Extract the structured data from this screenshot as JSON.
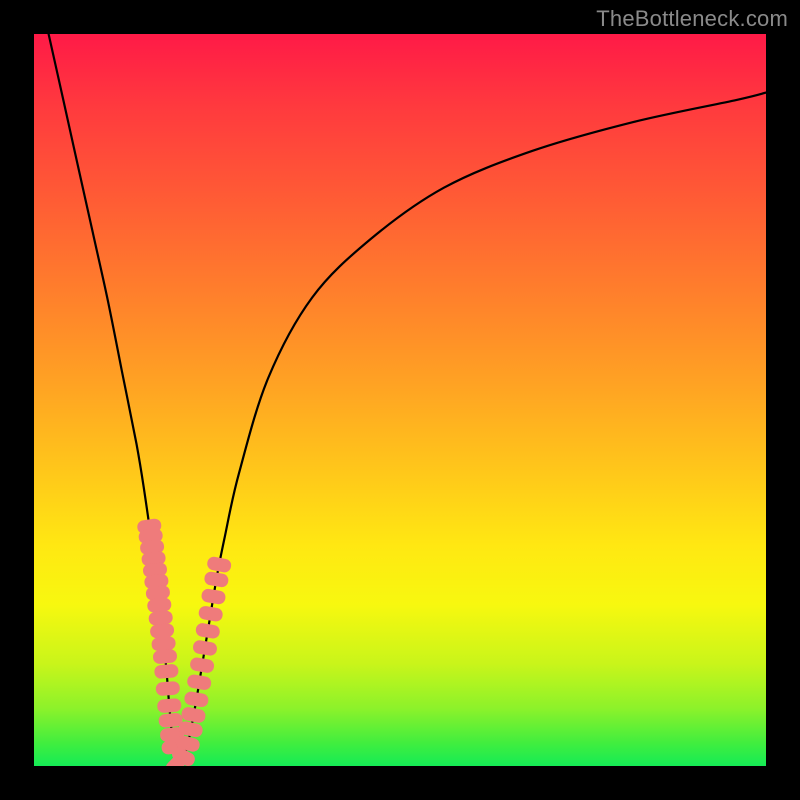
{
  "watermark": "TheBottleneck.com",
  "chart_data": {
    "type": "line",
    "title": "",
    "xlabel": "",
    "ylabel": "",
    "xlim": [
      0,
      100
    ],
    "ylim": [
      0,
      100
    ],
    "grid": false,
    "series": [
      {
        "name": "bottleneck-curve",
        "color": "#000000",
        "x": [
          2,
          4,
          6,
          8,
          10,
          12,
          14,
          15,
          16,
          17,
          18,
          18.5,
          19,
          19.5,
          20,
          21,
          22,
          23,
          24,
          25,
          26,
          28,
          32,
          38,
          46,
          56,
          68,
          82,
          96,
          100
        ],
        "y": [
          100,
          91,
          82,
          73,
          64,
          54,
          44,
          38,
          31,
          23,
          14,
          8,
          3,
          0,
          0,
          3,
          8,
          14,
          20,
          26,
          31,
          40,
          53,
          64,
          72,
          79,
          84,
          88,
          91,
          92
        ]
      },
      {
        "name": "dot-overlay",
        "color": "#ef7b7b",
        "style": "dots-along-curve",
        "x_range": [
          13.8,
          25.5
        ],
        "y_max": 34
      }
    ],
    "annotations": []
  }
}
